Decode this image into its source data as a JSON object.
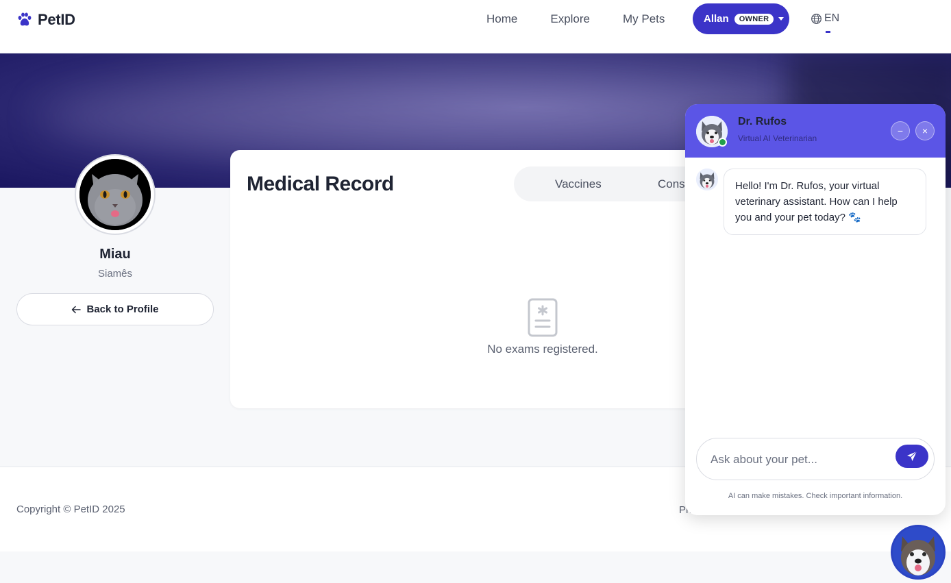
{
  "brand": {
    "name": "PetID"
  },
  "nav": {
    "links": [
      "Home",
      "Explore",
      "My Pets"
    ]
  },
  "user": {
    "name": "Allan",
    "role_badge": "OWNER"
  },
  "lang": {
    "code": "EN"
  },
  "pet": {
    "name": "Miau",
    "breed": "Siamês"
  },
  "profile": {
    "back_label": "Back to Profile"
  },
  "medical": {
    "title": "Medical Record",
    "tabs": [
      "Vaccines",
      "Cons"
    ],
    "empty_text": "No exams registered."
  },
  "footer": {
    "copyright": "Copyright © PetID 2025",
    "right_text": "Pri"
  },
  "chat": {
    "bot_name": "Dr. Rufos",
    "bot_role": "Virtual AI Veterinarian",
    "minimize_symbol": "−",
    "close_symbol": "×",
    "greeting": "Hello! I'm Dr. Rufos, your virtual veterinary assistant. How can I help you and your pet today? 🐾",
    "input_placeholder": "Ask about your pet...",
    "disclaimer": "AI can make mistakes. Check important information."
  },
  "colors": {
    "accent": "#3b34c8",
    "chat_header": "#5b55e6",
    "online": "#22a04a"
  },
  "icons": [
    "paw-icon",
    "globe-icon",
    "caret-down-icon",
    "arrow-left-icon",
    "document-medical-icon",
    "send-icon"
  ]
}
